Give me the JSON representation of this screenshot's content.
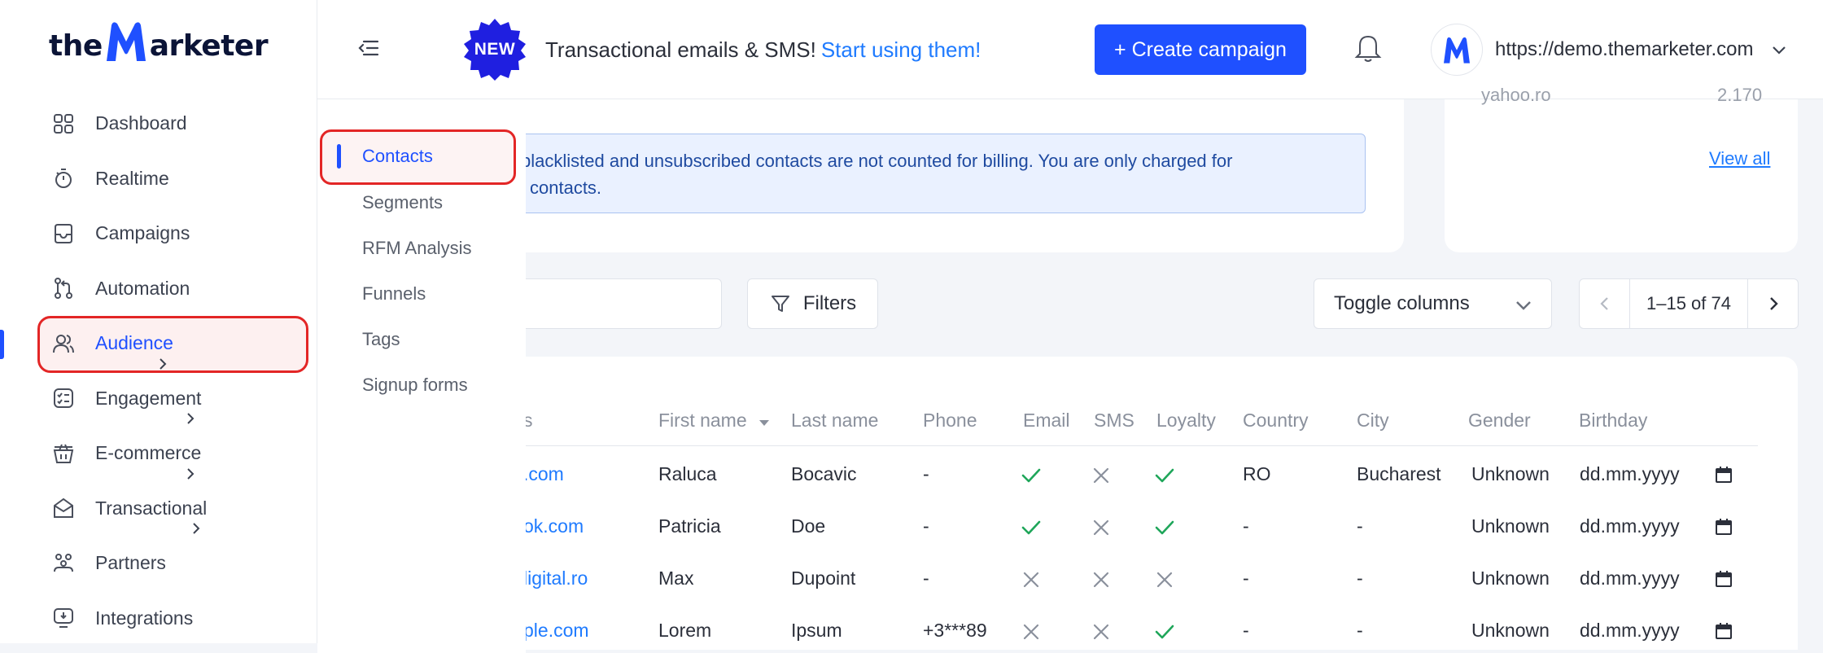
{
  "brand": {
    "logo_left": "the",
    "logo_right": "arketer"
  },
  "sidebar": {
    "items": [
      {
        "label": "Dashboard",
        "icon": "dashboard-grid-icon"
      },
      {
        "label": "Realtime",
        "icon": "stopwatch-icon"
      },
      {
        "label": "Campaigns",
        "icon": "campaign-folder-icon"
      },
      {
        "label": "Automation",
        "icon": "automation-flow-icon"
      },
      {
        "label": "Audience",
        "icon": "users-icon",
        "active": true
      },
      {
        "label": "Engagement",
        "icon": "engagement-checklist-icon"
      },
      {
        "label": "E-commerce",
        "icon": "basket-icon"
      },
      {
        "label": "Transactional",
        "icon": "envelope-icon"
      },
      {
        "label": "Partners",
        "icon": "partners-icon"
      },
      {
        "label": "Integrations",
        "icon": "integrations-monitor-icon"
      }
    ]
  },
  "topbar": {
    "new_badge": "NEW",
    "announcement": "Transactional emails & SMS!",
    "announcement_link": "Start using them!",
    "create_button": "+ Create campaign",
    "store_url": "https://demo.themarketer.com"
  },
  "submenu": {
    "items": [
      "Contacts",
      "Segments",
      "RFM Analysis",
      "Funnels",
      "Tags",
      "Signup forms"
    ],
    "active": "Contacts"
  },
  "info_banner": {
    "line1": "blacklisted and unsubscribed contacts are not counted for billing. You are only charged for",
    "line2": "l contacts."
  },
  "right_card": {
    "cut_label": "yahoo.ro",
    "cut_value": "2.170",
    "view_all": "View all"
  },
  "toolbar": {
    "filters_label": "Filters",
    "toggle_columns_label": "Toggle columns",
    "pagination_range": "1–15 of 74"
  },
  "table": {
    "headers": [
      "s",
      "First name",
      "Last name",
      "Phone",
      "Email",
      "SMS",
      "Loyalty",
      "Country",
      "City",
      "Gender",
      "Birthday"
    ],
    "rows": [
      {
        "email": ".com",
        "first": "Raluca",
        "last": "Bocavic",
        "phone": "-",
        "email_ok": true,
        "sms_ok": false,
        "loyalty_ok": true,
        "country": "RO",
        "city": "Bucharest",
        "gender": "Unknown",
        "birthday": "dd.mm.yyyy"
      },
      {
        "email": "ok.com",
        "first": "Patricia",
        "last": "Doe",
        "phone": "-",
        "email_ok": true,
        "sms_ok": false,
        "loyalty_ok": true,
        "country": "-",
        "city": "-",
        "gender": "Unknown",
        "birthday": "dd.mm.yyyy"
      },
      {
        "email": "ligital.ro",
        "first": "Max",
        "last": "Dupoint",
        "phone": "-",
        "email_ok": false,
        "sms_ok": false,
        "loyalty_ok": false,
        "country": "-",
        "city": "-",
        "gender": "Unknown",
        "birthday": "dd.mm.yyyy"
      },
      {
        "email": "ple.com",
        "first": "Lorem",
        "last": "Ipsum",
        "phone": "+3***89",
        "email_ok": false,
        "sms_ok": false,
        "loyalty_ok": true,
        "country": "-",
        "city": "-",
        "gender": "Unknown",
        "birthday": "dd.mm.yyyy"
      }
    ]
  },
  "colors": {
    "accent": "#1f50ff",
    "link": "#1f7bff",
    "check": "#1fa65a",
    "cross": "#8a909c",
    "highlight": "#e32626"
  }
}
